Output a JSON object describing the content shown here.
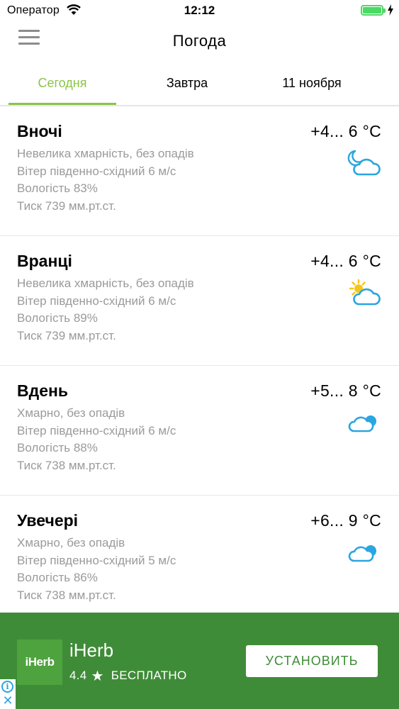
{
  "status_bar": {
    "carrier": "Оператор",
    "time": "12:12"
  },
  "nav": {
    "title": "Погода"
  },
  "tabs": [
    {
      "label": "Сегодня",
      "active": true
    },
    {
      "label": "Завтра",
      "active": false
    },
    {
      "label": "11 ноября",
      "active": false
    }
  ],
  "periods": [
    {
      "name": "Вночі",
      "temp": "+4... 6 °C",
      "description": "Невелика хмарність, без опадів",
      "wind": "Вітер південно-східний 6 м/с",
      "humidity": "Вологість 83%",
      "pressure": "Тиск 739 мм.рт.ст.",
      "icon": "moon-cloud-icon"
    },
    {
      "name": "Вранці",
      "temp": "+4... 6 °C",
      "description": "Невелика хмарність, без опадів",
      "wind": "Вітер південно-східний 6 м/с",
      "humidity": "Вологість 89%",
      "pressure": "Тиск 739 мм.рт.ст.",
      "icon": "sun-cloud-icon"
    },
    {
      "name": "Вдень",
      "temp": "+5... 8 °C",
      "description": "Хмарно, без опадів",
      "wind": "Вітер південно-східний 6 м/с",
      "humidity": "Вологість 88%",
      "pressure": "Тиск 738 мм.рт.ст.",
      "icon": "cloudy-icon"
    },
    {
      "name": "Увечері",
      "temp": "+6... 9 °C",
      "description": "Хмарно, без опадів",
      "wind": "Вітер південно-східний 5 м/с",
      "humidity": "Вологість 86%",
      "pressure": "Тиск 738 мм.рт.ст.",
      "icon": "cloudy-icon"
    }
  ],
  "ad": {
    "logo_text": "iHerb",
    "title": "iHerb",
    "rating": "4.4",
    "price": "БЕСПЛАТНО",
    "install_label": "УСТАНОВИТЬ"
  },
  "colors": {
    "accent": "#8bc34a",
    "ad_background": "#3f8c38",
    "icon_blue": "#2aa6e0",
    "icon_sun": "#f5c518",
    "battery": "#4cd964"
  }
}
